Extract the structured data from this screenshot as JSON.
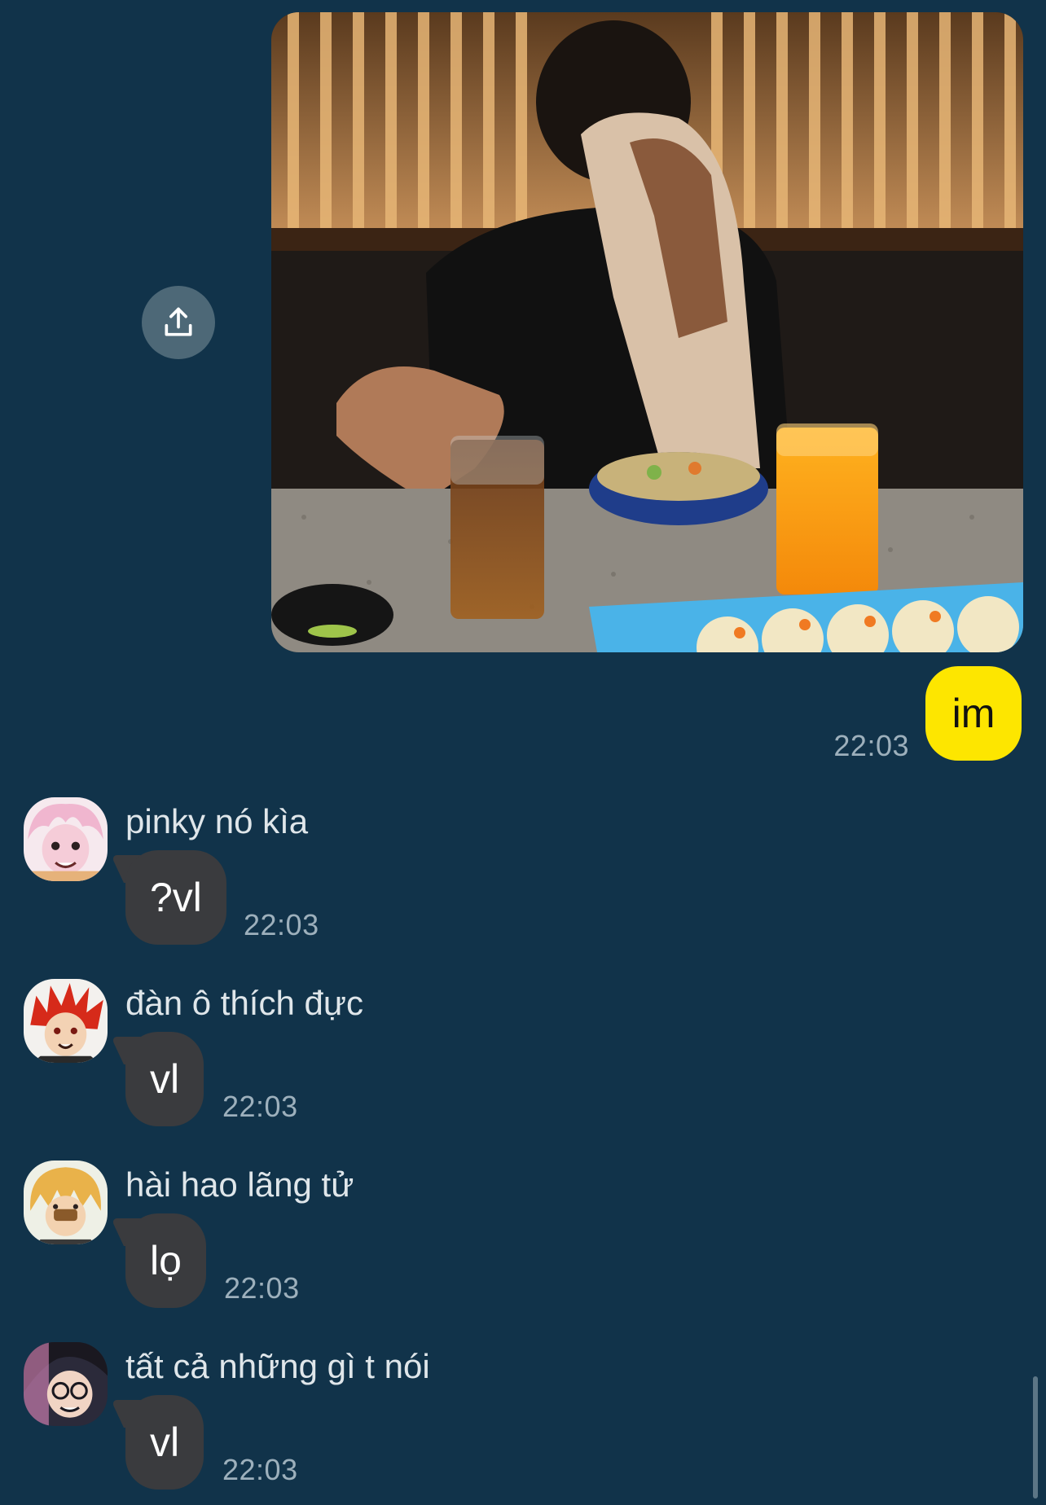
{
  "chat": {
    "outgoing": {
      "share_icon": "share-upload-icon",
      "text": "im",
      "time": "22:03"
    },
    "messages": [
      {
        "sender": "pinky nó kìa",
        "text": "?vl",
        "time": "22:03",
        "avatar_icon": "pink-hair-anime-avatar"
      },
      {
        "sender": "đàn ô thích đực",
        "text": "vl",
        "time": "22:03",
        "avatar_icon": "red-spiky-hair-anime-avatar"
      },
      {
        "sender": "hài hao lãng tử",
        "text": "lọ",
        "time": "22:03",
        "avatar_icon": "blonde-hair-anime-avatar"
      },
      {
        "sender": "tất cả những gì t nói",
        "text": "vl",
        "time": "22:03",
        "avatar_icon": "glasses-anime-avatar"
      }
    ]
  },
  "colors": {
    "background": "#11334a",
    "outgoing_bubble": "#fde600",
    "incoming_bubble": "#3a3b3e",
    "timestamp": "#9db0bc"
  }
}
